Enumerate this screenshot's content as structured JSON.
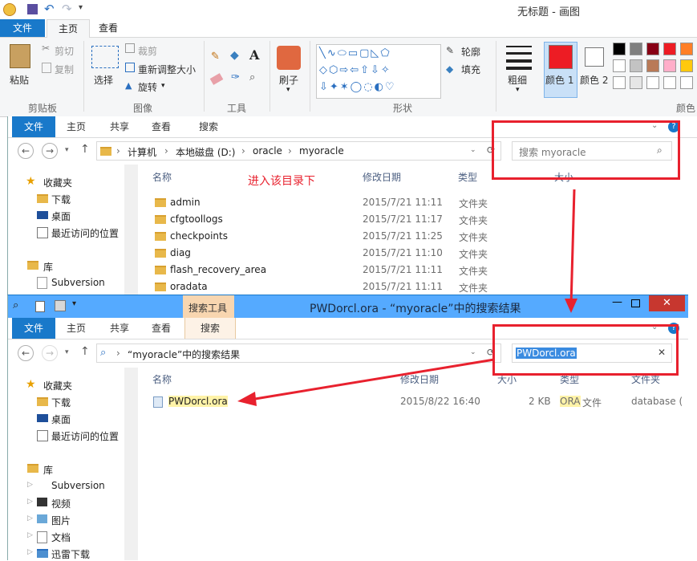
{
  "paint": {
    "title": "无标题 - 画图",
    "tabs": [
      "文件",
      "主页",
      "查看"
    ],
    "clipboard": {
      "paste": "粘贴",
      "cut": "剪切",
      "copy": "复制",
      "label": "剪贴板"
    },
    "image": {
      "select": "选择",
      "crop": "裁剪",
      "resize": "重新调整大小",
      "rotate": "旋转",
      "label": "图像"
    },
    "tools": {
      "label": "工具"
    },
    "brush": {
      "label": "刷子"
    },
    "shapes": {
      "outline": "轮廓",
      "fill": "填充",
      "label": "形状"
    },
    "size": {
      "label": "粗细"
    },
    "colors": {
      "color1": "颜色 1",
      "color2": "颜色 2",
      "label": "颜色",
      "palette": [
        "#000000",
        "#7f7f7f",
        "#880015",
        "#ed1c24",
        "#ff7f27",
        "#ffffff",
        "#c3c3c3",
        "#b97a57",
        "#ffaec9",
        "#ffc90e",
        "#ffffff",
        "#e6e6e6",
        "#ffffff",
        "#ffffff",
        "#ffffff"
      ],
      "color1_value": "#ed1c24",
      "color2_value": "#ffffff"
    }
  },
  "explorer1": {
    "tabs": [
      "文件",
      "主页",
      "共享",
      "查看",
      "搜索"
    ],
    "breadcrumb": [
      "计算机",
      "本地磁盘 (D:)",
      "oracle",
      "myoracle"
    ],
    "search_placeholder": "搜索 myoracle",
    "annotation": "进入该目录下",
    "nav": {
      "favorites": "收藏夹",
      "downloads": "下载",
      "desktop": "桌面",
      "recent": "最近访问的位置",
      "library": "库",
      "subversion": "Subversion"
    },
    "columns": {
      "name": "名称",
      "date": "修改日期",
      "type": "类型",
      "size": "大小"
    },
    "rows": [
      {
        "name": "admin",
        "date": "2015/7/21 11:11",
        "type": "文件夹"
      },
      {
        "name": "cfgtoollogs",
        "date": "2015/7/21 11:17",
        "type": "文件夹"
      },
      {
        "name": "checkpoints",
        "date": "2015/7/21 11:25",
        "type": "文件夹"
      },
      {
        "name": "diag",
        "date": "2015/7/21 11:10",
        "type": "文件夹"
      },
      {
        "name": "flash_recovery_area",
        "date": "2015/7/21 11:11",
        "type": "文件夹"
      },
      {
        "name": "oradata",
        "date": "2015/7/21 11:11",
        "type": "文件夹"
      }
    ]
  },
  "explorer2": {
    "search_tools_tab": "搜索工具",
    "title": "PWDorcl.ora - “myoracle”中的搜索结果",
    "tabs": [
      "文件",
      "主页",
      "共享",
      "查看",
      "搜索"
    ],
    "address": "“myoracle”中的搜索结果",
    "search_value": "PWDorcl.ora",
    "nav": {
      "favorites": "收藏夹",
      "downloads": "下载",
      "desktop": "桌面",
      "recent": "最近访问的位置",
      "library": "库",
      "subversion": "Subversion",
      "videos": "视频",
      "pictures": "图片",
      "documents": "文档",
      "thunder": "迅雷下载"
    },
    "columns": {
      "name": "名称",
      "date": "修改日期",
      "size": "大小",
      "type": "类型",
      "folder": "文件夹"
    },
    "result": {
      "name": "PWDorcl.ora",
      "date": "2015/8/22 16:40",
      "size": "2 KB",
      "type_ext": "ORA",
      "type_word": "文件",
      "folder": "database ("
    }
  }
}
